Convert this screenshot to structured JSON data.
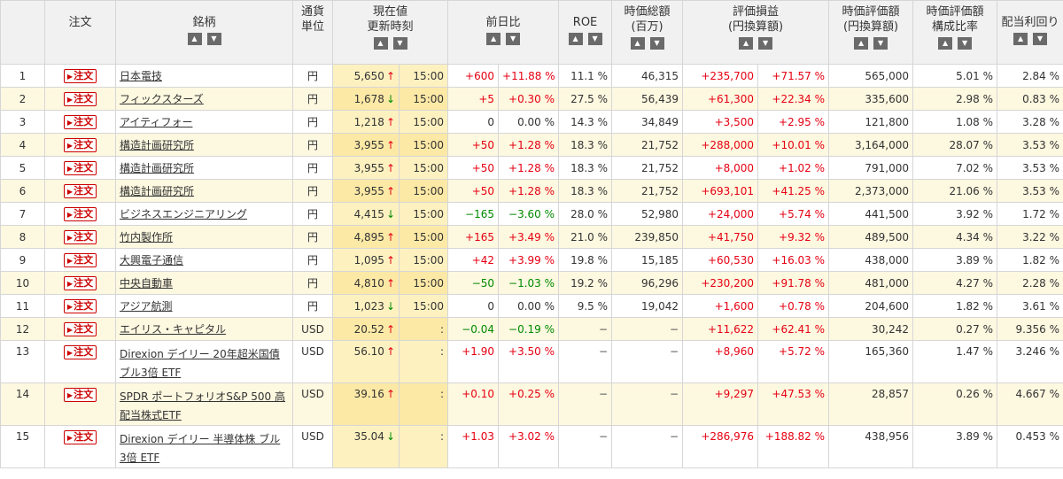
{
  "headers": {
    "order": "注文",
    "name": "銘柄",
    "currency_1": "通貨",
    "currency_2": "単位",
    "price_1": "現在値",
    "price_2": "更新時刻",
    "change": "前日比",
    "roe": "ROE",
    "mcap_1": "時価総額",
    "mcap_2": "(百万)",
    "pl_1": "評価損益",
    "pl_2": "(円換算額)",
    "value_1": "時価評価額",
    "value_2": "(円換算額)",
    "ratio_1": "時価評価額",
    "ratio_2": "構成比率",
    "yield": "配当利回り",
    "sort_up": "▲",
    "sort_down": "▼"
  },
  "order_label": "注文",
  "order_icon": "▶",
  "rows": [
    {
      "no": "1",
      "name": "日本電技",
      "cur": "円",
      "price": "5,650",
      "dir": "↑",
      "time": "15:00",
      "chg": "+600",
      "chgp": "+11.88 %",
      "roe": "11.1 %",
      "mcap": "46,315",
      "pl": "+235,700",
      "plp": "+71.57 %",
      "value": "565,000",
      "ratio": "5.01 %",
      "yield": "2.84 %"
    },
    {
      "no": "2",
      "name": "フィックスターズ",
      "cur": "円",
      "price": "1,678",
      "dir": "↓",
      "time": "15:00",
      "chg": "+5",
      "chgp": "+0.30 %",
      "roe": "27.5 %",
      "mcap": "56,439",
      "pl": "+61,300",
      "plp": "+22.34 %",
      "value": "335,600",
      "ratio": "2.98 %",
      "yield": "0.83 %"
    },
    {
      "no": "3",
      "name": "アイティフォー",
      "cur": "円",
      "price": "1,218",
      "dir": "↑",
      "time": "15:00",
      "chg": "0",
      "chgp": "0.00 %",
      "roe": "14.3 %",
      "mcap": "34,849",
      "pl": "+3,500",
      "plp": "+2.95 %",
      "value": "121,800",
      "ratio": "1.08 %",
      "yield": "3.28 %"
    },
    {
      "no": "4",
      "name": "構造計画研究所",
      "cur": "円",
      "price": "3,955",
      "dir": "↑",
      "time": "15:00",
      "chg": "+50",
      "chgp": "+1.28 %",
      "roe": "18.3 %",
      "mcap": "21,752",
      "pl": "+288,000",
      "plp": "+10.01 %",
      "value": "3,164,000",
      "ratio": "28.07 %",
      "yield": "3.53 %"
    },
    {
      "no": "5",
      "name": "構造計画研究所",
      "cur": "円",
      "price": "3,955",
      "dir": "↑",
      "time": "15:00",
      "chg": "+50",
      "chgp": "+1.28 %",
      "roe": "18.3 %",
      "mcap": "21,752",
      "pl": "+8,000",
      "plp": "+1.02 %",
      "value": "791,000",
      "ratio": "7.02 %",
      "yield": "3.53 %"
    },
    {
      "no": "6",
      "name": "構造計画研究所",
      "cur": "円",
      "price": "3,955",
      "dir": "↑",
      "time": "15:00",
      "chg": "+50",
      "chgp": "+1.28 %",
      "roe": "18.3 %",
      "mcap": "21,752",
      "pl": "+693,101",
      "plp": "+41.25 %",
      "value": "2,373,000",
      "ratio": "21.06 %",
      "yield": "3.53 %"
    },
    {
      "no": "7",
      "name": "ビジネスエンジニアリング",
      "cur": "円",
      "price": "4,415",
      "dir": "↓",
      "time": "15:00",
      "chg": "−165",
      "chgp": "−3.60 %",
      "roe": "28.0 %",
      "mcap": "52,980",
      "pl": "+24,000",
      "plp": "+5.74 %",
      "value": "441,500",
      "ratio": "3.92 %",
      "yield": "1.72 %"
    },
    {
      "no": "8",
      "name": "竹内製作所",
      "cur": "円",
      "price": "4,895",
      "dir": "↑",
      "time": "15:00",
      "chg": "+165",
      "chgp": "+3.49 %",
      "roe": "21.0 %",
      "mcap": "239,850",
      "pl": "+41,750",
      "plp": "+9.32 %",
      "value": "489,500",
      "ratio": "4.34 %",
      "yield": "3.22 %"
    },
    {
      "no": "9",
      "name": "大興電子通信",
      "cur": "円",
      "price": "1,095",
      "dir": "↑",
      "time": "15:00",
      "chg": "+42",
      "chgp": "+3.99 %",
      "roe": "19.8 %",
      "mcap": "15,185",
      "pl": "+60,530",
      "plp": "+16.03 %",
      "value": "438,000",
      "ratio": "3.89 %",
      "yield": "1.82 %"
    },
    {
      "no": "10",
      "name": "中央自動車",
      "cur": "円",
      "price": "4,810",
      "dir": "↑",
      "time": "15:00",
      "chg": "−50",
      "chgp": "−1.03 %",
      "roe": "19.2 %",
      "mcap": "96,296",
      "pl": "+230,200",
      "plp": "+91.78 %",
      "value": "481,000",
      "ratio": "4.27 %",
      "yield": "2.28 %"
    },
    {
      "no": "11",
      "name": "アジア航測",
      "cur": "円",
      "price": "1,023",
      "dir": "↓",
      "time": "15:00",
      "chg": "0",
      "chgp": "0.00 %",
      "roe": "9.5 %",
      "mcap": "19,042",
      "pl": "+1,600",
      "plp": "+0.78 %",
      "value": "204,600",
      "ratio": "1.82 %",
      "yield": "3.61 %"
    },
    {
      "no": "12",
      "name": "エイリス・キャピタル",
      "cur": "USD",
      "price": "20.52",
      "dir": "↑",
      "time": ":",
      "chg": "−0.04",
      "chgp": "−0.19 %",
      "roe": "−",
      "mcap": "−",
      "pl": "+11,622",
      "plp": "+62.41 %",
      "value": "30,242",
      "ratio": "0.27 %",
      "yield": "9.356 %"
    },
    {
      "no": "13",
      "name": "Direxion デイリー 20年超米国債 ブル3倍 ETF",
      "cur": "USD",
      "price": "56.10",
      "dir": "↑",
      "time": ":",
      "chg": "+1.90",
      "chgp": "+3.50 %",
      "roe": "−",
      "mcap": "−",
      "pl": "+8,960",
      "plp": "+5.72 %",
      "value": "165,360",
      "ratio": "1.47 %",
      "yield": "3.246 %"
    },
    {
      "no": "14",
      "name": "SPDR ポートフォリオS&P 500 高配当株式ETF",
      "cur": "USD",
      "price": "39.16",
      "dir": "↑",
      "time": ":",
      "chg": "+0.10",
      "chgp": "+0.25 %",
      "roe": "−",
      "mcap": "−",
      "pl": "+9,297",
      "plp": "+47.53 %",
      "value": "28,857",
      "ratio": "0.26 %",
      "yield": "4.667 %"
    },
    {
      "no": "15",
      "name": "Direxion デイリー 半導体株 ブル 3倍 ETF",
      "cur": "USD",
      "price": "35.04",
      "dir": "↓",
      "time": ":",
      "chg": "+1.03",
      "chgp": "+3.02 %",
      "roe": "−",
      "mcap": "−",
      "pl": "+286,976",
      "plp": "+188.82 %",
      "value": "438,956",
      "ratio": "3.89 %",
      "yield": "0.453 %"
    }
  ]
}
